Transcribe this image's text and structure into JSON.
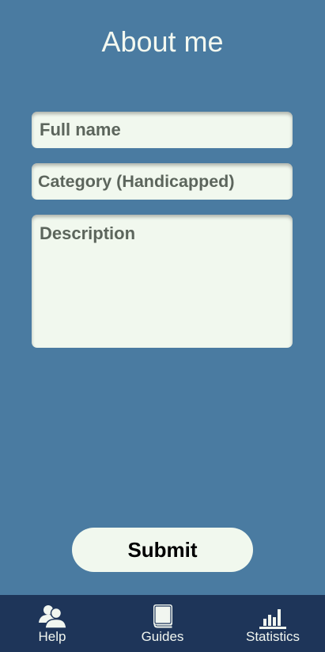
{
  "header": {
    "title": "About me"
  },
  "form": {
    "full_name": {
      "placeholder": "Full name",
      "value": ""
    },
    "category": {
      "placeholder": "Category (Handicapped)",
      "value": ""
    },
    "description": {
      "placeholder": "Description",
      "value": ""
    },
    "submit_label": "Submit"
  },
  "nav": {
    "items": [
      {
        "label": "Help",
        "icon": "people-icon"
      },
      {
        "label": "Guides",
        "icon": "book-icon"
      },
      {
        "label": "Statistics",
        "icon": "bar-chart-icon"
      }
    ]
  },
  "colors": {
    "background": "#4a7ba1",
    "field_bg": "#f1f8ee",
    "nav_bg": "#1e3559",
    "text_light": "#f3f8f0"
  }
}
